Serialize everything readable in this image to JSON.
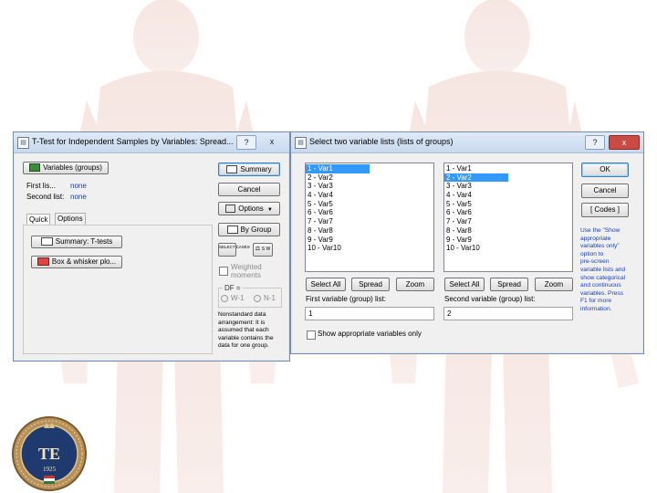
{
  "dialog1": {
    "title": "T-Test for Independent Samples by Variables: Spread...",
    "help_glyph": "?",
    "close_glyph": "x",
    "variables_button": "Variables (groups)",
    "first_list_label": "First lis...",
    "first_list_value": "none",
    "second_list_label": "Second list:",
    "second_list_value": "none",
    "tabs": [
      "Quick",
      "Options"
    ],
    "summary_ttests_button": "Summary: T-tests",
    "box_whisker_button": "Box & whisker plo...",
    "right_buttons": {
      "summary": "Summary",
      "cancel": "Cancel",
      "options": "Options",
      "by_group": "By Group"
    },
    "sel_cond_label": "SELECT CASES",
    "sw_label": "S W",
    "weighted_moments_label": "Weighted\nmoments",
    "df_label": "DF =",
    "df_options": [
      "W-1",
      "N-1"
    ],
    "note": "Nonstandard data\narrangement: It is\nassumed that each\nvariable contains the\ndata for one group."
  },
  "dialog2": {
    "title": "Select two variable lists (lists of groups)",
    "help_glyph": "?",
    "close_glyph": "x",
    "list1": [
      "1 - Var1",
      "2 - Var2",
      "3 - Var3",
      "4 - Var4",
      "5 - Var5",
      "6 - Var6",
      "7 - Var7",
      "8 - Var8",
      "9 - Var9",
      "10 - Var10"
    ],
    "list2": [
      "1 - Var1",
      "2 - Var2",
      "3 - Var3",
      "4 - Var4",
      "5 - Var5",
      "6 - Var6",
      "7 - Var7",
      "8 - Var8",
      "9 - Var9",
      "10 - Var10"
    ],
    "list1_selected": "1 - Var1",
    "list2_selected": "2 - Var2",
    "select_all": "Select All",
    "spread": "Spread",
    "zoom": "Zoom",
    "first_label": "First variable (group) list:",
    "first_value": "1",
    "second_label": "Second variable (group) list:",
    "second_value": "2",
    "show_appropriate": "Show appropriate variables only",
    "ok": "OK",
    "cancel": "Cancel",
    "codes": "[ Codes ]",
    "help_text": "Use the \"Show\nappropriate\nvariables only\"\noption to\npre-screen\nvariable lists and\nshow categorical\nand continuous\nvariables. Press\nF1 for more\ninformation."
  },
  "logo": {
    "initials": "TE",
    "year": "1925"
  },
  "colors": {
    "title_bar": "#c7d8ee",
    "selection": "#3399ff",
    "link_blue": "#1a3fb8",
    "close_red": "#c94b43"
  }
}
